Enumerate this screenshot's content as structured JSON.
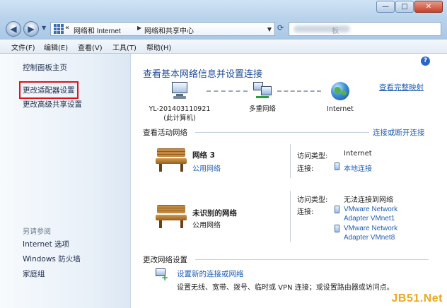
{
  "window": {
    "minimize_glyph": "—",
    "maximize_glyph": "□",
    "close_glyph": "✕"
  },
  "address_bar": {
    "breadcrumb_prefix": "«",
    "crumbs": [
      "网络和 Internet",
      "网络和共享中心"
    ],
    "search_visible_text": "板"
  },
  "menu": [
    "文件(F)",
    "编辑(E)",
    "查看(V)",
    "工具(T)",
    "帮助(H)"
  ],
  "left_pane": {
    "links": [
      "控制面板主页",
      "更改适配器设置",
      "更改高级共享设置"
    ],
    "highlighted_link_index": 1,
    "see_also_title": "另请参阅",
    "see_also_links": [
      "Internet 选项",
      "Windows 防火墙",
      "家庭组"
    ]
  },
  "main": {
    "title": "查看基本网络信息并设置连接",
    "full_map_link": "查看完整映射",
    "map_nodes": [
      {
        "icon": "computer-icon",
        "label_line1": "YL-201403110921",
        "label_line2": "(此计算机)"
      },
      {
        "icon": "multiple-networks-icon",
        "label_line1": "多重网络",
        "label_line2": ""
      },
      {
        "icon": "globe-icon",
        "label_line1": "Internet",
        "label_line2": ""
      }
    ],
    "active_section": {
      "title": "查看活动网络",
      "connect_link": "连接或断开连接"
    },
    "networks": [
      {
        "name": "网络  3",
        "type": "公用网络",
        "access_type_label": "访问类型:",
        "access_type_value": "Internet",
        "connections_label": "连接:",
        "connections": [
          "本地连接"
        ]
      },
      {
        "name": "未识别的网络",
        "type": "公用网络",
        "access_type_label": "访问类型:",
        "access_type_value": "无法连接到网络",
        "connections_label": "连接:",
        "connections": [
          "VMware Network",
          "Adapter VMnet1",
          "VMware Network",
          "Adapter VMnet8"
        ]
      }
    ],
    "change_section": {
      "title": "更改网络设置",
      "setup_link": "设置新的连接或网络",
      "setup_description": "设置无线、宽带、拨号、临时或 VPN 连接；或设置路由器或访问点。"
    },
    "help_glyph": "?"
  },
  "watermark": "JB51.Net",
  "colors": {
    "link": "#1f5fb5",
    "title": "#1f4d99",
    "highlight_box": "#e0101c"
  }
}
